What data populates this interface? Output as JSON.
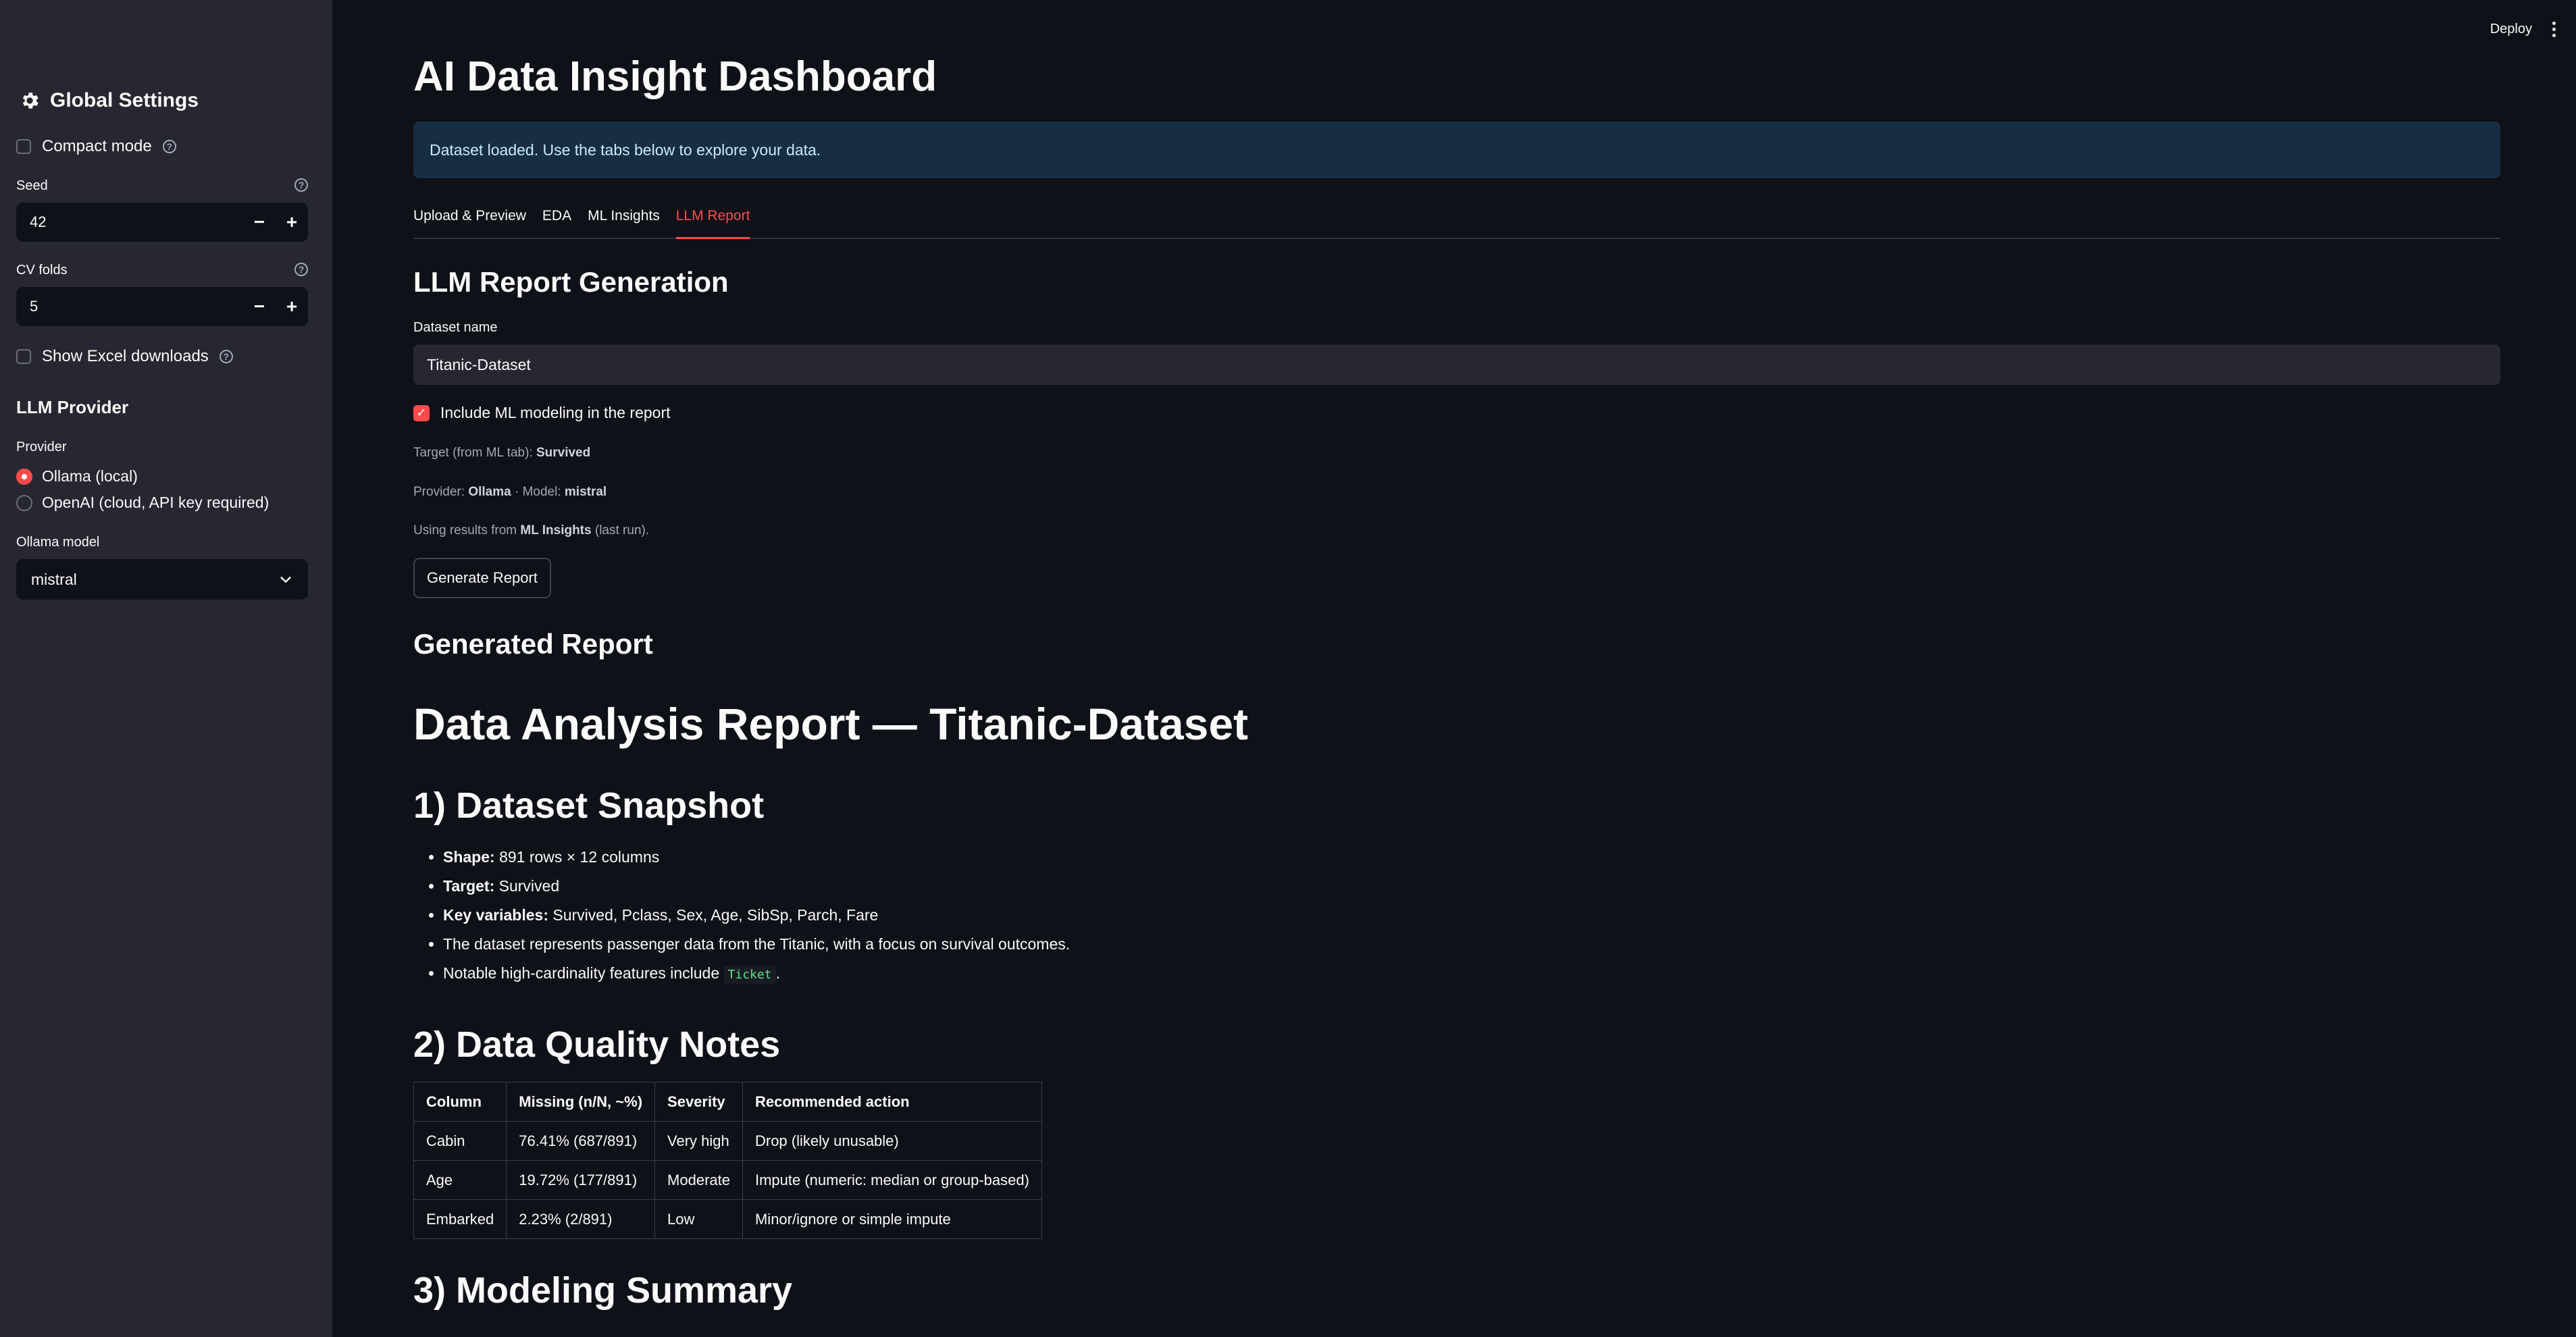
{
  "sidebar": {
    "title": "Global Settings",
    "compact_mode_label": "Compact mode",
    "seed_label": "Seed",
    "seed_value": "42",
    "cv_folds_label": "CV folds",
    "cv_folds_value": "5",
    "show_excel_label": "Show Excel downloads",
    "llm_provider_heading": "LLM Provider",
    "provider_label": "Provider",
    "provider_options": [
      "Ollama (local)",
      "OpenAI (cloud, API key required)"
    ],
    "provider_selected": "Ollama (local)",
    "ollama_model_label": "Ollama model",
    "ollama_model_value": "mistral",
    "step_minus": "−",
    "step_plus": "+"
  },
  "topbar": {
    "deploy_label": "Deploy"
  },
  "main": {
    "title": "AI Data Insight Dashboard",
    "info_message": "Dataset loaded. Use the tabs below to explore your data.",
    "tabs": [
      {
        "label": "Upload & Preview",
        "active": false
      },
      {
        "label": "EDA",
        "active": false
      },
      {
        "label": "ML Insights",
        "active": false
      },
      {
        "label": "LLM Report",
        "active": true
      }
    ],
    "section_title": "LLM Report Generation",
    "dataset_name_label": "Dataset name",
    "dataset_name_value": "Titanic-Dataset",
    "include_ml_label": "Include ML modeling in the report",
    "target_caption_prefix": "Target (from ML tab): ",
    "target_value": "Survived",
    "provider_caption_prefix": "Provider: ",
    "provider_value": "Ollama",
    "model_caption_prefix": " · Model: ",
    "model_value": "mistral",
    "results_caption_prefix": "Using results from ",
    "results_source": "ML Insights",
    "results_caption_suffix": " (last run).",
    "generate_button": "Generate Report",
    "generated_heading": "Generated Report"
  },
  "report": {
    "title": "Data Analysis Report — Titanic-Dataset",
    "section1_title": "1) Dataset Snapshot",
    "snapshot": {
      "shape_label": "Shape:",
      "shape_value": " 891 rows × 12 columns",
      "target_label": "Target:",
      "target_value": " Survived",
      "keyvars_label": "Key variables:",
      "keyvars_value": " Survived, Pclass, Sex, Age, SibSp, Parch, Fare",
      "description": "The dataset represents passenger data from the Titanic, with a focus on survival outcomes.",
      "cardinality_prefix": "Notable high-cardinality features include ",
      "cardinality_code": "Ticket",
      "cardinality_suffix": "."
    },
    "section2_title": "2) Data Quality Notes",
    "quality_table": {
      "headers": [
        "Column",
        "Missing (n/N, ~%)",
        "Severity",
        "Recommended action"
      ],
      "rows": [
        [
          "Cabin",
          "76.41% (687/891)",
          "Very high",
          "Drop (likely unusable)"
        ],
        [
          "Age",
          "19.72% (177/891)",
          "Moderate",
          "Impute (numeric: median or group-based)"
        ],
        [
          "Embarked",
          "2.23% (2/891)",
          "Low",
          "Minor/ignore or simple impute"
        ]
      ]
    },
    "section3_title": "3) Modeling Summary"
  }
}
